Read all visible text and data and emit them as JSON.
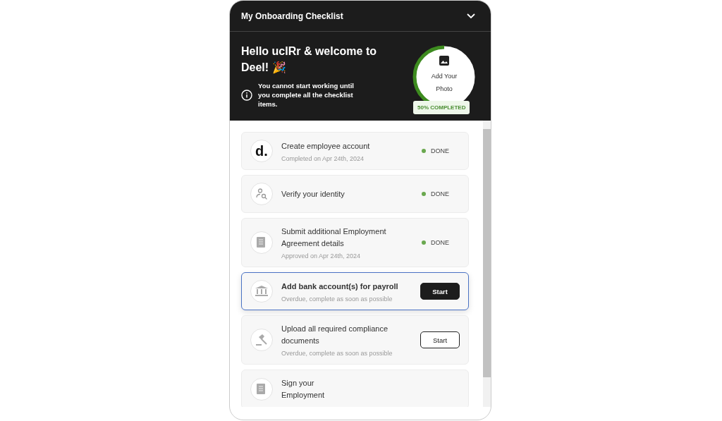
{
  "panel": {
    "title": "My Onboarding Checklist",
    "expanded": true
  },
  "hero": {
    "greeting": "Hello uclRr & welcome to Deel!",
    "emoji": "🎉",
    "notice": "You cannot start working until you complete all the checklist items.",
    "photo_label": "Add Your Photo",
    "progress": {
      "label": "50% COMPLETED"
    }
  },
  "items": [
    {
      "kind": "logo",
      "logo_text": "d.",
      "title": "Create employee account",
      "subtitle": "Completed on Apr 24th, 2024",
      "status_label": "DONE",
      "selected": false
    },
    {
      "kind": "identity",
      "title": "Verify your identity",
      "status_label": "DONE",
      "selected": false
    },
    {
      "kind": "document",
      "title": "Submit additional Employment Agreement details",
      "subtitle": "Approved on Apr 24th, 2024",
      "status_label": "DONE",
      "selected": false
    },
    {
      "kind": "bank",
      "title": "Add bank account(s) for payroll",
      "subtitle": "Overdue, complete as soon as possible",
      "action": "Start",
      "selected": true
    },
    {
      "kind": "gavel",
      "title": "Upload all required compliance documents",
      "subtitle": "Overdue, complete as soon as possible",
      "action": "Start",
      "selected": false
    },
    {
      "kind": "document",
      "title": "Sign your Employment",
      "selected": false
    }
  ]
}
